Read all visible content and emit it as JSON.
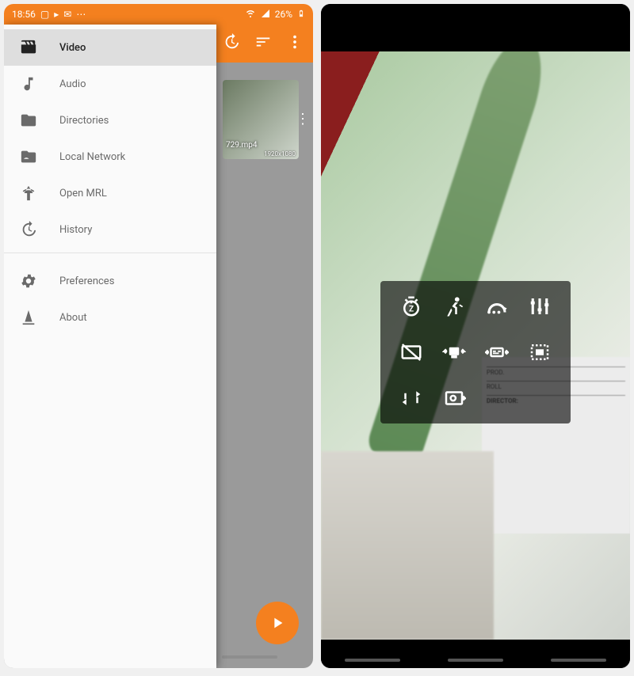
{
  "statusbar": {
    "time": "18:56",
    "battery_text": "26%"
  },
  "backdrop": {
    "thumbnail_filename": "729.mp4",
    "thumbnail_resolution": "1920x1080"
  },
  "drawer": {
    "items": [
      {
        "id": "video",
        "label": "Video",
        "icon": "movie-icon",
        "selected": true
      },
      {
        "id": "audio",
        "label": "Audio",
        "icon": "music-note-icon"
      },
      {
        "id": "directories",
        "label": "Directories",
        "icon": "folder-icon"
      },
      {
        "id": "local-network",
        "label": "Local Network",
        "icon": "network-folder-icon"
      },
      {
        "id": "open-mrl",
        "label": "Open MRL",
        "icon": "antenna-icon"
      },
      {
        "id": "history",
        "label": "History",
        "icon": "history-icon"
      }
    ],
    "footer_items": [
      {
        "id": "preferences",
        "label": "Preferences",
        "icon": "gear-icon"
      },
      {
        "id": "about",
        "label": "About",
        "icon": "cone-icon"
      }
    ]
  },
  "clapper": {
    "prod": "PROD.",
    "roll": "ROLL",
    "director": "DIRECTOR:"
  },
  "player_overlay": {
    "buttons": [
      {
        "id": "sleep-timer",
        "name": "sleep-timer-button",
        "icon": "alarm-snooze-icon"
      },
      {
        "id": "playback-speed",
        "name": "playback-speed-button",
        "icon": "running-person-icon"
      },
      {
        "id": "jump-to",
        "name": "jump-to-button",
        "icon": "jump-arc-icon"
      },
      {
        "id": "equalizer",
        "name": "equalizer-button",
        "icon": "sliders-icon"
      },
      {
        "id": "popup",
        "name": "popup-disabled-button",
        "icon": "popup-disabled-icon"
      },
      {
        "id": "audio-track",
        "name": "audio-track-button",
        "icon": "audio-track-icon"
      },
      {
        "id": "subtitle-track",
        "name": "subtitle-track-button",
        "icon": "subtitle-track-icon"
      },
      {
        "id": "crop",
        "name": "crop-button",
        "icon": "crop-select-icon"
      },
      {
        "id": "repeat",
        "name": "repeat-button",
        "icon": "repeat-icon"
      },
      {
        "id": "pip",
        "name": "pip-button",
        "icon": "pip-icon"
      }
    ]
  },
  "colors": {
    "accent": "#f4801f"
  }
}
